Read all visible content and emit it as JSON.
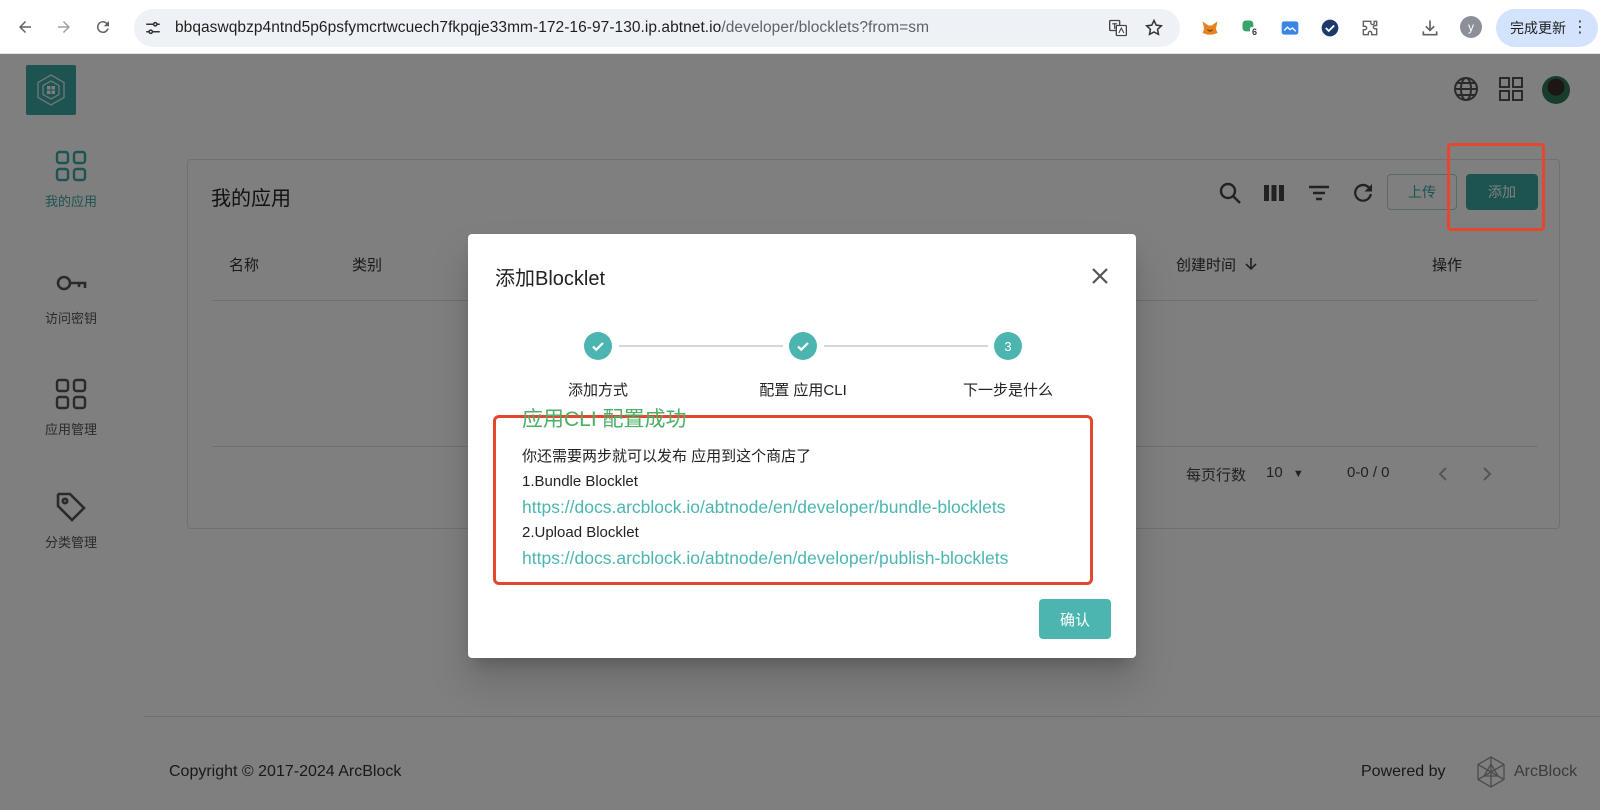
{
  "browser": {
    "url_host": "bbqaswqbzp4ntnd5p6psfymcrtwcuech7fkpqje33mm-172-16-97-130.ip.abtnet.io",
    "url_path": "/developer/blocklets?from=sm",
    "extension_badge": "6",
    "profile_initial": "y",
    "update_label": "完成更新"
  },
  "sidebar": {
    "items": [
      {
        "label": "我的应用",
        "icon": "grid-icon",
        "active": true
      },
      {
        "label": "访问密钥",
        "icon": "key-icon",
        "active": false
      },
      {
        "label": "应用管理",
        "icon": "grid-icon",
        "active": false
      },
      {
        "label": "分类管理",
        "icon": "tag-icon",
        "active": false
      }
    ]
  },
  "main": {
    "title": "我的应用",
    "upload_label": "上传",
    "add_label": "添加",
    "columns": [
      "名称",
      "类别",
      "创建时间",
      "操作"
    ],
    "rows_per_page_label": "每页行数",
    "rows_per_page": "10",
    "range": "0-0 / 0"
  },
  "footer": {
    "copyright": "Copyright © 2017-2024  ArcBlock",
    "powered_by": "Powered by",
    "brand": "ArcBlock"
  },
  "dialog": {
    "title": "添加Blocklet",
    "steps": [
      {
        "label": "添加方式",
        "done": true,
        "number": "1"
      },
      {
        "label": "配置 应用CLI",
        "done": true,
        "number": "2"
      },
      {
        "label": "下一步是什么",
        "done": false,
        "number": "3"
      }
    ],
    "success_text": "应用CLI 配置成功",
    "intro": "你还需要两步就可以发布 应用到这个商店了",
    "step1_title": "1.Bundle Blocklet",
    "step1_link": "https://docs.arcblock.io/abtnode/en/developer/bundle-blocklets",
    "step2_title": "2.Upload Blocklet",
    "step2_link": "https://docs.arcblock.io/abtnode/en/developer/publish-blocklets",
    "confirm_label": "确认"
  },
  "colors": {
    "accent": "#4cb5b0",
    "success": "#4cae67",
    "highlight": "#e5472e"
  }
}
